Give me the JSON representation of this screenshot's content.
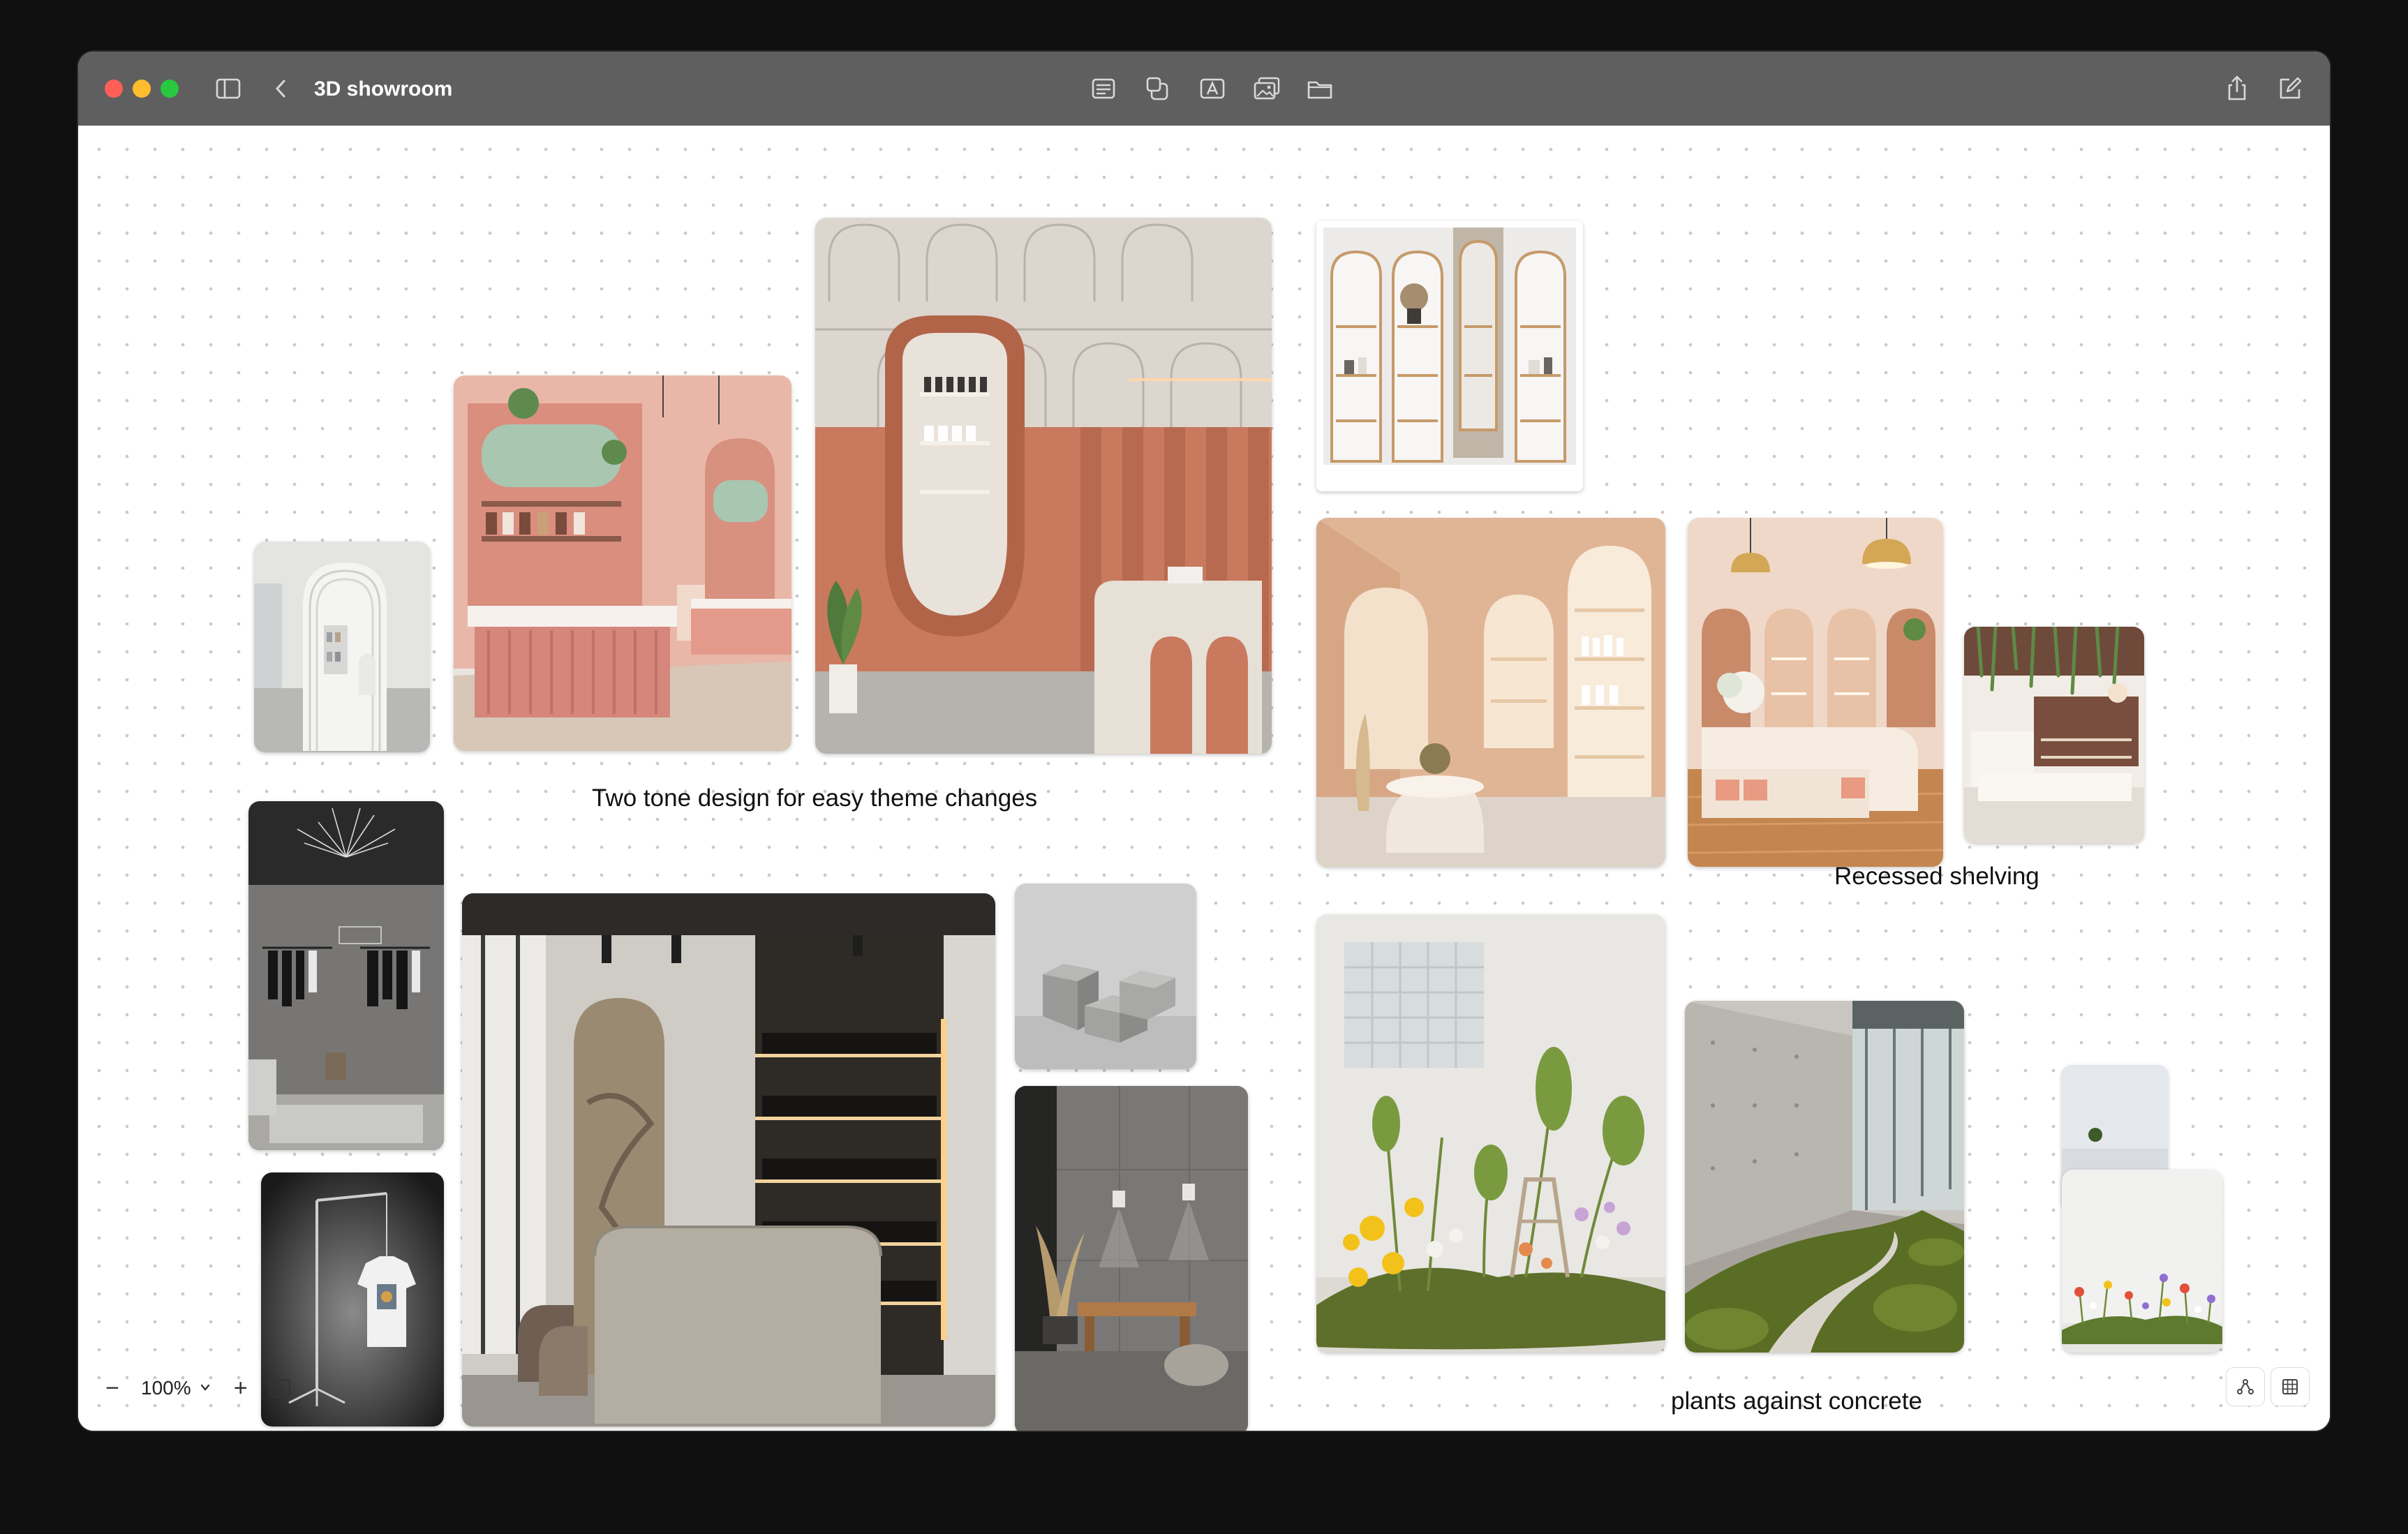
{
  "window": {
    "title": "3D showroom"
  },
  "toolbar": {
    "icons": [
      "sidebar-icon",
      "back-chevron-icon",
      "text-block-icon",
      "shapes-icon",
      "text-box-icon",
      "media-icon",
      "folder-icon",
      "share-icon",
      "compose-icon"
    ]
  },
  "captions": {
    "two_tone": "Two tone design for easy theme changes",
    "recessed": "Recessed shelving",
    "plants": "plants against concrete"
  },
  "zoom": {
    "value": "100%",
    "minus": "−",
    "plus": "+"
  },
  "colors": {
    "titlebar": "#5f5f5f",
    "terracotta": "#c97a5e",
    "blush": "#e8bfae",
    "concrete": "#9c9c9a",
    "moss": "#6b7f2e"
  }
}
